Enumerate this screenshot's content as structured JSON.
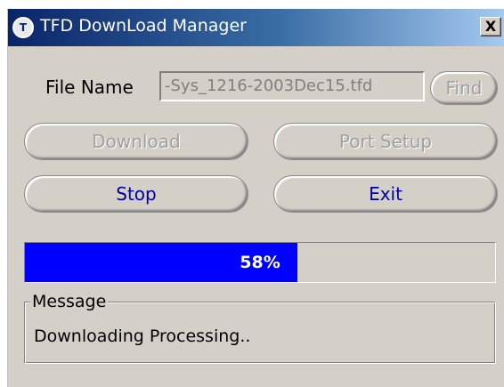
{
  "window": {
    "title": "TFD DownLoad Manager",
    "icon": "tfd-app-icon",
    "close_label": "X",
    "titlebar_color": "#0a246a"
  },
  "file": {
    "label": "File Name",
    "value": "-Sys_1216-2003Dec15.tfd",
    "find_label": "Find"
  },
  "buttons": {
    "download_label": "Download",
    "port_setup_label": "Port Setup",
    "stop_label": "Stop",
    "exit_label": "Exit"
  },
  "progress": {
    "value": 0.58,
    "text": "58%",
    "fill_color": "#0000ff"
  },
  "message": {
    "legend": "Message",
    "text": "Downloading Processing.."
  }
}
